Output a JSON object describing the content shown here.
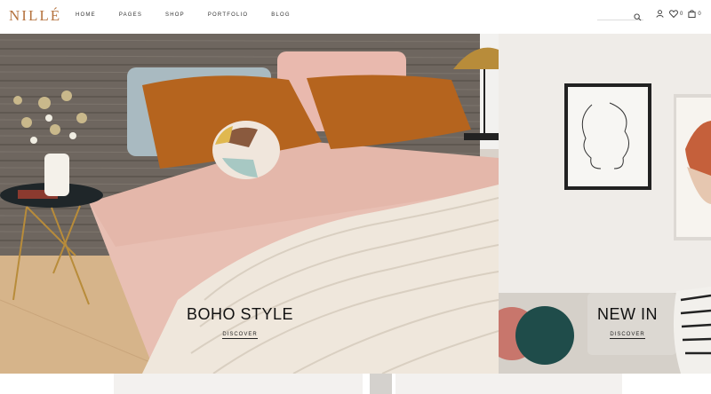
{
  "brand": {
    "logo": "NILLÉ",
    "accent": "#b5733f"
  },
  "nav": [
    {
      "label": "HOME"
    },
    {
      "label": "PAGES"
    },
    {
      "label": "SHOP"
    },
    {
      "label": "PORTFOLIO"
    },
    {
      "label": "BLOG"
    }
  ],
  "header_tools": {
    "search_placeholder": "",
    "wishlist_count": "0",
    "cart_count": "0"
  },
  "banners": [
    {
      "title": "BOHO STYLE",
      "link": "DISCOVER"
    },
    {
      "title": "NEW IN",
      "link": "DISCOVER"
    }
  ]
}
